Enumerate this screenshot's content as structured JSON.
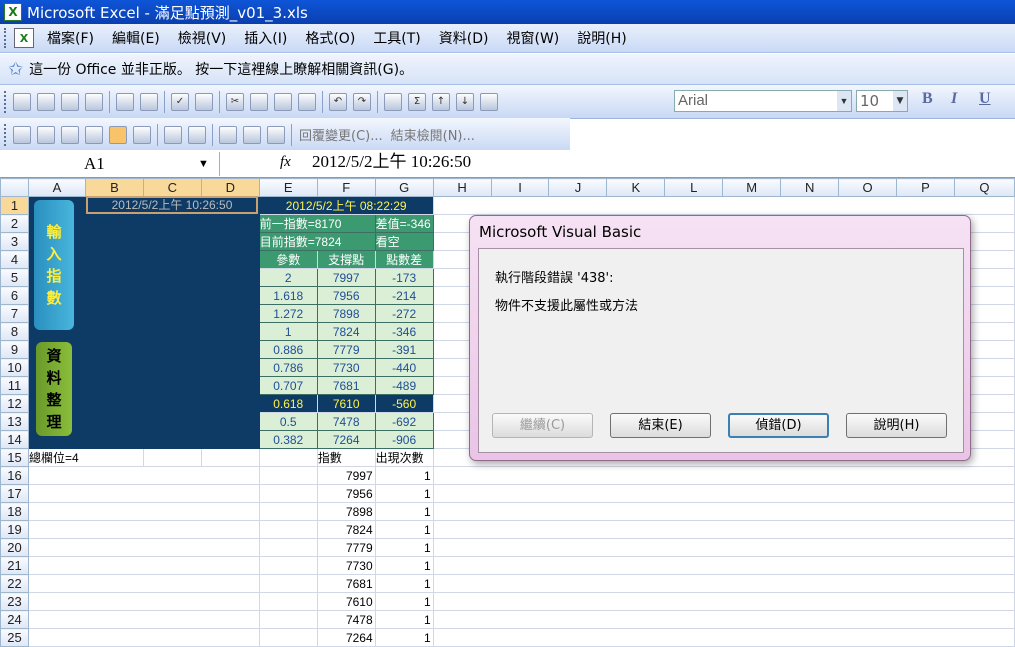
{
  "title": "Microsoft Excel - 滿足點預測_v01_3.xls",
  "menus": [
    "檔案(F)",
    "編輯(E)",
    "檢視(V)",
    "插入(I)",
    "格式(O)",
    "工具(T)",
    "資料(D)",
    "視窗(W)",
    "說明(H)"
  ],
  "infobar": {
    "text": "這一份 Office 並非正版。 按一下這裡線上瞭解相關資訊(G)。"
  },
  "toolbar": {
    "font": "Arial",
    "size": "10",
    "review_label": "回覆變更(C)...",
    "end_review_label": "結束檢閱(N)..."
  },
  "formula_bar": {
    "name_box": "A1",
    "fx": "fx",
    "formula": "2012/5/2上午 10:26:50"
  },
  "columns": [
    "A",
    "B",
    "C",
    "D",
    "E",
    "F",
    "G",
    "H",
    "I",
    "J",
    "K",
    "L",
    "M",
    "N",
    "O",
    "P",
    "Q"
  ],
  "rows": [
    "1",
    "2",
    "3",
    "4",
    "5",
    "6",
    "7",
    "8",
    "9",
    "10",
    "11",
    "12",
    "13",
    "14",
    "15",
    "16",
    "17",
    "18",
    "19",
    "20",
    "21",
    "22",
    "23",
    "24",
    "25"
  ],
  "sheet": {
    "timestamp_box": "2012/5/2上午 10:26:50",
    "e1": "2012/5/2上午 08:22:29",
    "prev_index": "前一指數=8170",
    "diff": "差值=-346",
    "curr_index": "目前指數=7824",
    "trend": "看空",
    "hdr_param": "參數",
    "hdr_support": "支撐點",
    "hdr_diff": "點數差",
    "table": [
      [
        "2",
        "7997",
        "-173"
      ],
      [
        "1.618",
        "7956",
        "-214"
      ],
      [
        "1.272",
        "7898",
        "-272"
      ],
      [
        "1",
        "7824",
        "-346"
      ],
      [
        "0.886",
        "7779",
        "-391"
      ],
      [
        "0.786",
        "7730",
        "-440"
      ],
      [
        "0.707",
        "7681",
        "-489"
      ],
      [
        "0.618",
        "7610",
        "-560"
      ],
      [
        "0.5",
        "7478",
        "-692"
      ],
      [
        "0.382",
        "7264",
        "-906"
      ]
    ],
    "total_cols": "總欄位=4",
    "hdr_index": "指數",
    "hdr_count": "出現次數",
    "counts": [
      [
        "7997",
        "1"
      ],
      [
        "7956",
        "1"
      ],
      [
        "7898",
        "1"
      ],
      [
        "7824",
        "1"
      ],
      [
        "7779",
        "1"
      ],
      [
        "7730",
        "1"
      ],
      [
        "7681",
        "1"
      ],
      [
        "7610",
        "1"
      ],
      [
        "7478",
        "1"
      ],
      [
        "7264",
        "1"
      ]
    ],
    "btn_input": [
      "輸",
      "入",
      "指",
      "數"
    ],
    "btn_organize": [
      "資",
      "料",
      "整",
      "理"
    ]
  },
  "dialog": {
    "title": "Microsoft Visual Basic",
    "line1": "執行階段錯誤 '438':",
    "line2": "物件不支援此屬性或方法",
    "btn_continue": "繼續(C)",
    "btn_end": "結束(E)",
    "btn_debug": "偵錯(D)",
    "btn_help": "說明(H)"
  }
}
